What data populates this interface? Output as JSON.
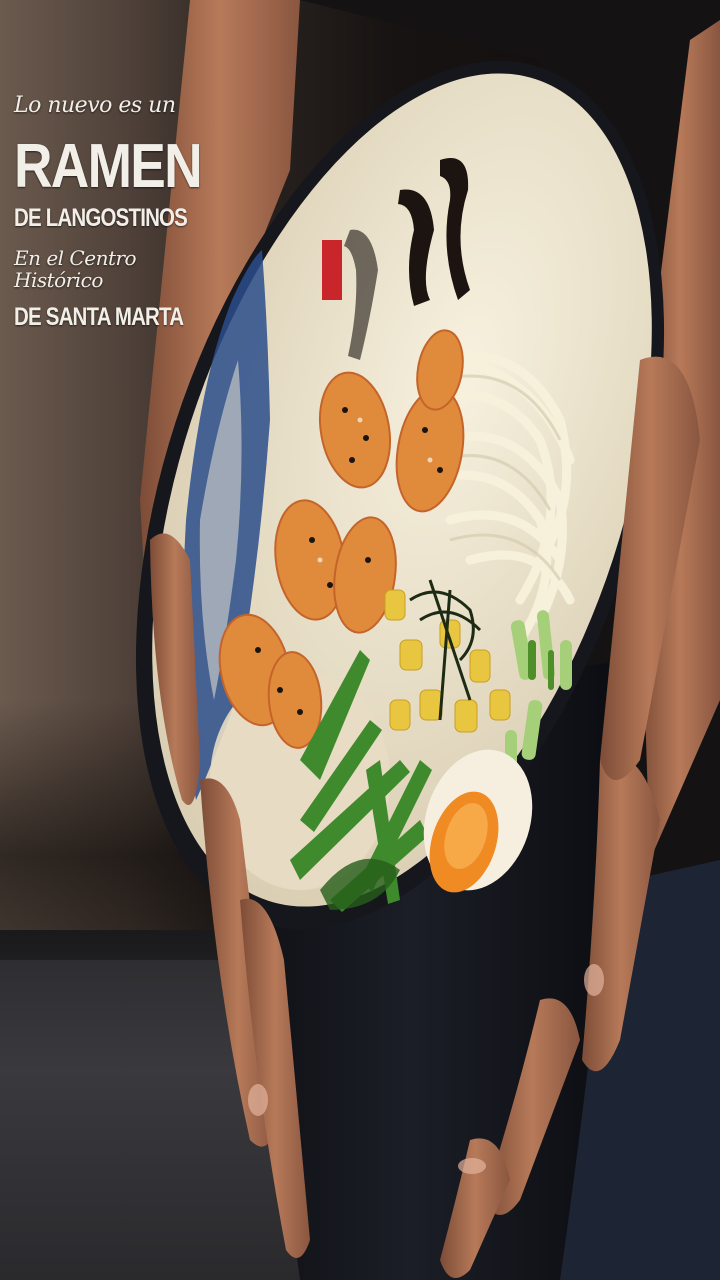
{
  "promo": {
    "line1": "Lo nuevo es un",
    "line2": "RAMEN",
    "line3": "DE LANGOSTINOS",
    "line4": "En el Centro Histórico",
    "line5": "DE SANTA MARTA"
  },
  "colors": {
    "bowl": "#12141a",
    "bowl_inner": "#efe7d2",
    "shrimp": "#e08a3c",
    "noodles": "#f6f0dc",
    "greens": "#3f8a2c",
    "corn": "#e9c640",
    "egg_yolk": "#f08a22",
    "skin": "#a86a4c"
  }
}
